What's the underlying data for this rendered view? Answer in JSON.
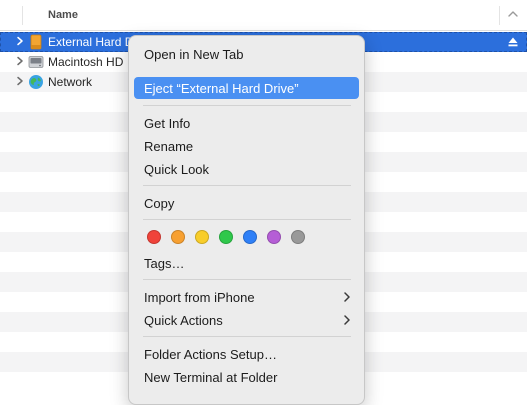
{
  "column_header": {
    "name": "Name"
  },
  "rows": [
    {
      "label": "External Hard Drive",
      "icon": "external-drive-icon",
      "selected": true
    },
    {
      "label": "Macintosh HD",
      "icon": "internal-drive-icon",
      "selected": false
    },
    {
      "label": "Network",
      "icon": "network-globe-icon",
      "selected": false
    }
  ],
  "context_menu": {
    "open_new_tab": "Open in New Tab",
    "eject": "Eject “External Hard Drive”",
    "get_info": "Get Info",
    "rename": "Rename",
    "quick_look": "Quick Look",
    "copy": "Copy",
    "tags": "Tags…",
    "import_iphone": "Import from iPhone",
    "quick_actions": "Quick Actions",
    "folder_actions": "Folder Actions Setup…",
    "new_terminal": "New Terminal at Folder",
    "tag_colors": [
      {
        "name": "Red",
        "color": "#f0433a"
      },
      {
        "name": "Orange",
        "color": "#f7a031"
      },
      {
        "name": "Yellow",
        "color": "#f8cd2a"
      },
      {
        "name": "Green",
        "color": "#2fc84b"
      },
      {
        "name": "Blue",
        "color": "#2f80f7"
      },
      {
        "name": "Purple",
        "color": "#b55ed6"
      },
      {
        "name": "Gray",
        "color": "#999999"
      }
    ]
  },
  "colors": {
    "selection": "#2c6fdc",
    "menu_highlight": "#4a90f2"
  }
}
